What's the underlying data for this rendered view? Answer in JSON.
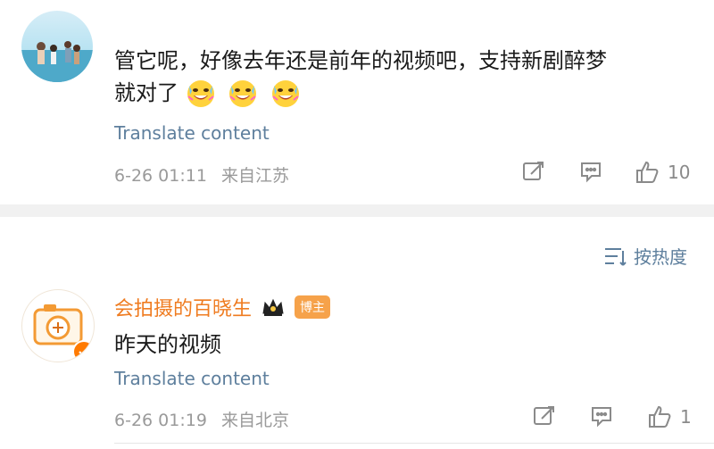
{
  "comments": [
    {
      "text_line1": "管它呢，好像去年还是前年的视频吧，支持新剧醉梦",
      "text_line2": "就对了",
      "emoji": [
        "grin-sweat-emoji",
        "grin-sweat-emoji",
        "grin-sweat-emoji"
      ],
      "translate": "Translate content",
      "time": "6-26 01:11",
      "location": "来自江苏",
      "likes": "10"
    },
    {
      "username": "会拍摄的百晓生",
      "badge": "博主",
      "text": "昨天的视频",
      "translate": "Translate content",
      "time": "6-26 01:19",
      "location": "来自北京",
      "likes": "1"
    }
  ],
  "sort_label": "按热度",
  "colors": {
    "translate": "#5e7f9d",
    "username": "#ef7c21",
    "badge": "#f6a24a",
    "verified": "#ff7a00"
  }
}
